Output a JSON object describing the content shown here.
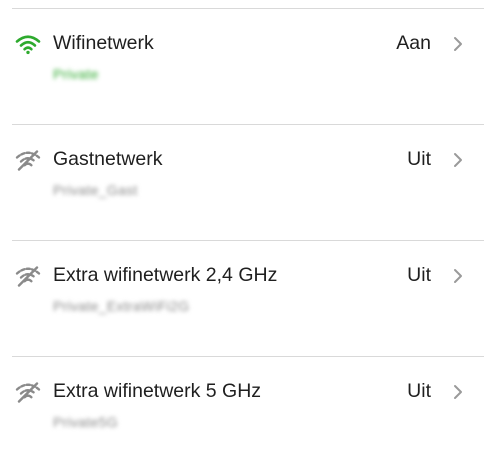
{
  "colors": {
    "active": "#2eaa2e",
    "inactive": "#8a8a8a",
    "divider": "#d9d9d9",
    "text": "#1f1f1f",
    "chevron": "#9a9a9a"
  },
  "networks": [
    {
      "title": "Wifinetwerk",
      "ssid": "Private",
      "status": "Aan",
      "icon": "wifi-on-icon"
    },
    {
      "title": "Gastnetwerk",
      "ssid": "Private_Gast",
      "status": "Uit",
      "icon": "wifi-off-icon"
    },
    {
      "title": "Extra wifinetwerk 2,4 GHz",
      "ssid": "Private_ExtraWiFi2G",
      "status": "Uit",
      "icon": "wifi-off-icon"
    },
    {
      "title": "Extra wifinetwerk 5 GHz",
      "ssid": "Private5G",
      "status": "Uit",
      "icon": "wifi-off-icon"
    }
  ]
}
